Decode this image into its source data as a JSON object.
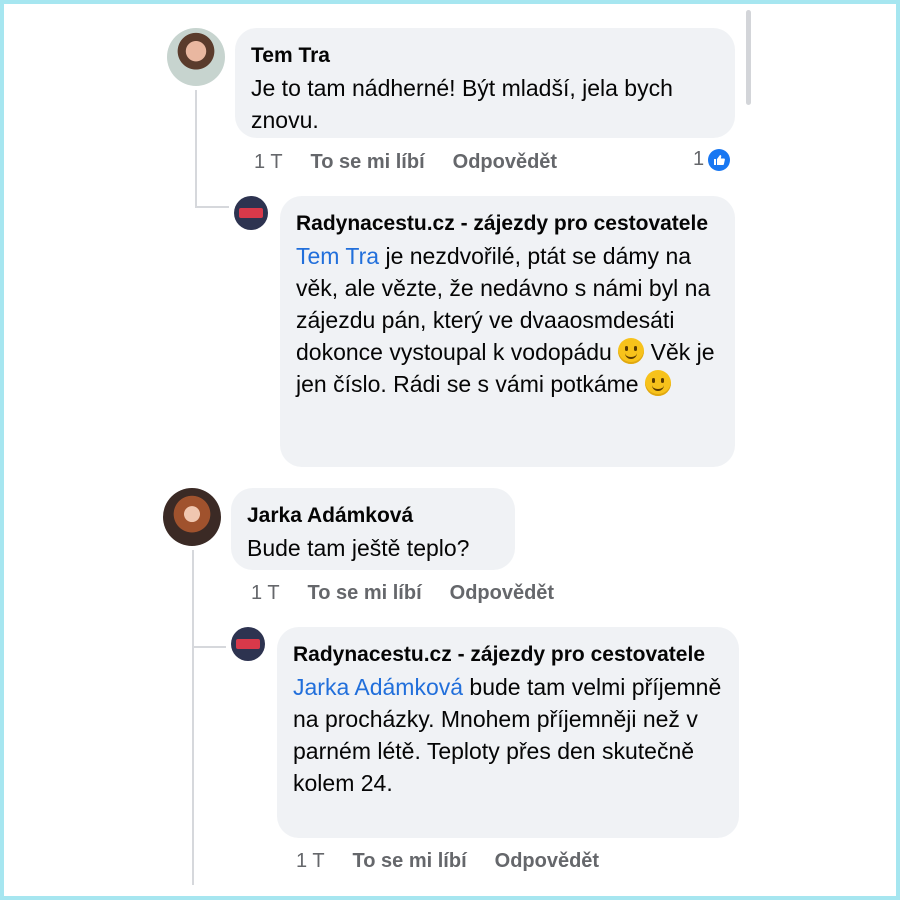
{
  "comments": [
    {
      "author": "Tem Tra",
      "text": "Je to tam nádherné! Být mladší, jela bych znovu.",
      "time": "1 T",
      "like_label": "To se mi líbí",
      "reply_label": "Odpovědět",
      "reaction_count": "1",
      "reaction_icon": "like-icon"
    },
    {
      "author": "Radynacestu.cz - zájezdy pro cestovatele",
      "mention": "Tem Tra",
      "text_1": " je nezdvořilé, ptát se dámy na věk, ale vězte, že nedávno s námi byl na zájezdu pán, který ve dvaaosmdesáti dokonce vystoupal k vodopádu ",
      "text_2": " Věk je jen číslo. Rádi se s vámi potkáme ",
      "emoji": "smile-emoji"
    },
    {
      "author": "Jarka Adámková",
      "text": "Bude tam ještě teplo?",
      "time": "1 T",
      "like_label": "To se mi líbí",
      "reply_label": "Odpovědět"
    },
    {
      "author": "Radynacestu.cz - zájezdy pro cestovatele",
      "mention": "Jarka Adámková",
      "text": " bude tam velmi příjemně na procházky. Mnohem příjemněji než v parném létě. Teploty přes den skutečně kolem 24.",
      "time": "1 T",
      "like_label": "To se mi líbí",
      "reply_label": "Odpovědět"
    }
  ],
  "colors": {
    "frame": "#a6e6f0",
    "bubble": "#f0f2f5",
    "mention": "#216fdb",
    "like": "#1877f2"
  }
}
